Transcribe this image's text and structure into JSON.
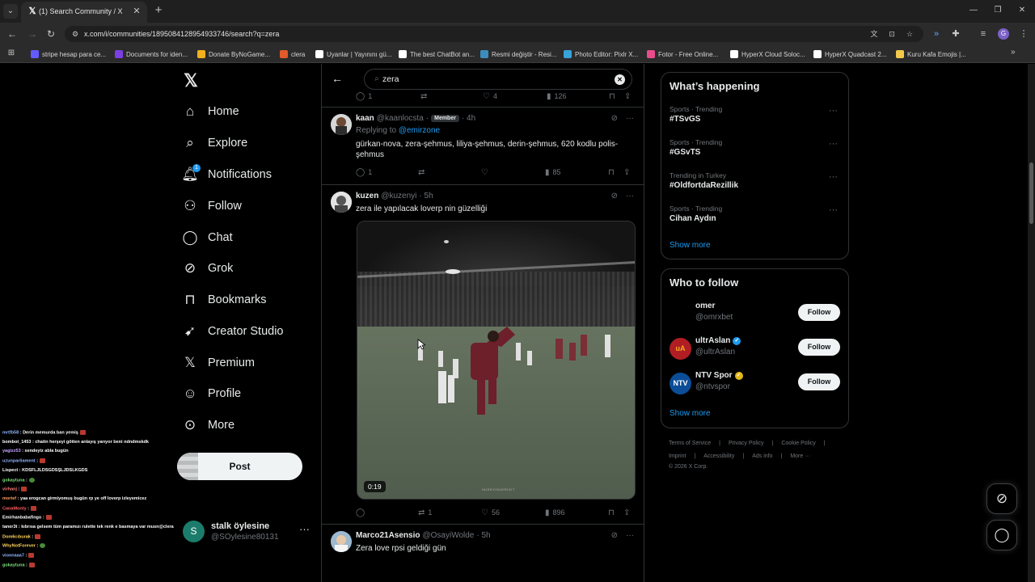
{
  "browser": {
    "tab_title": "(1) Search Community / X",
    "url": "x.com/i/communities/1895084128954933746/search?q=zera",
    "bookmarks": [
      {
        "label": "stripe hesap para ce...",
        "color": "#635bff"
      },
      {
        "label": "Documents for iden...",
        "color": "#7b3fe4"
      },
      {
        "label": "Donate ByNoGame...",
        "color": "#f2b01e"
      },
      {
        "label": "clera",
        "color": "#e05a2b"
      },
      {
        "label": "Uyanlar | Yayınını gü...",
        "color": "#ffffff"
      },
      {
        "label": "The best ChatBot an...",
        "color": "#ffffff"
      },
      {
        "label": "Resmi değiştir - Resi...",
        "color": "#3c8dbc"
      },
      {
        "label": "Photo Editor: Pixlr X...",
        "color": "#36a3d9"
      },
      {
        "label": "Fotor - Free Online...",
        "color": "#e84c8b"
      },
      {
        "label": "HyperX Cloud Soloc...",
        "color": "#ffffff"
      },
      {
        "label": "HyperX Quadcast 2...",
        "color": "#ffffff"
      },
      {
        "label": "Kuru Kafa Emojis |...",
        "color": "#f2c94c"
      }
    ]
  },
  "nav": {
    "items": [
      {
        "label": "Home",
        "icon": "home-icon"
      },
      {
        "label": "Explore",
        "icon": "search-icon"
      },
      {
        "label": "Notifications",
        "icon": "bell-icon",
        "badge": "1"
      },
      {
        "label": "Follow",
        "icon": "follow-icon"
      },
      {
        "label": "Chat",
        "icon": "chat-icon"
      },
      {
        "label": "Grok",
        "icon": "grok-icon"
      },
      {
        "label": "Bookmarks",
        "icon": "bookmark-icon"
      },
      {
        "label": "Creator Studio",
        "icon": "rocket-icon"
      },
      {
        "label": "Premium",
        "icon": "x-icon"
      },
      {
        "label": "Profile",
        "icon": "person-icon"
      },
      {
        "label": "More",
        "icon": "more-circle-icon"
      }
    ],
    "post_label": "Post",
    "account": {
      "avatar_letter": "S",
      "name": "stalk öylesine",
      "handle": "@SOylesine80131"
    }
  },
  "search": {
    "query": "zera"
  },
  "top_actions": {
    "replies": "1",
    "reposts": "",
    "likes": "4",
    "views": "126"
  },
  "tweets": [
    {
      "name": "kaan",
      "handle": "@kaanlocsta",
      "badge": "Member",
      "time": "· 4h",
      "replying_prefix": "Replying to",
      "replying_to": "@emirzone",
      "text": "gürkan-nova, zera-şehmus, liliya-şehmus, derin-şehmus, 620 kodlu polis-şehmus",
      "replies": "1",
      "reposts": "",
      "likes": "",
      "views": "85"
    },
    {
      "name": "kuzen",
      "handle": "@kuzenyi",
      "time": "· 5h",
      "text": "zera ile yapılacak loverp nin güzelliği",
      "video_duration": "0:19",
      "video_watermark": "HUSEYINVERIGIT",
      "replies": "",
      "reposts": "1",
      "likes": "56",
      "views": "896"
    },
    {
      "name": "Marco21Asensio",
      "handle": "@OsayiWolde",
      "time": "· 5h",
      "text": "Zera love rpsi geldiği gün"
    }
  ],
  "whats_happening": {
    "title": "What’s happening",
    "trends": [
      {
        "meta": "Sports · Trending",
        "name": "#TSvGS"
      },
      {
        "meta": "Sports · Trending",
        "name": "#GSvTS"
      },
      {
        "meta": "Trending in Turkey",
        "name": "#OldfortdaRezillik"
      },
      {
        "meta": "Sports · Trending",
        "name": "Cihan Aydın"
      }
    ],
    "show_more": "Show more"
  },
  "who_to_follow": {
    "title": "Who to follow",
    "accounts": [
      {
        "name": "omer",
        "handle": "@omrxbet",
        "verified": "",
        "avatar_text": ""
      },
      {
        "name": "ultrAslan",
        "handle": "@ultrAslan",
        "verified": "blue",
        "avatar_text": "uA"
      },
      {
        "name": "NTV Spor",
        "handle": "@ntvspor",
        "verified": "gold",
        "avatar_text": "NTV"
      }
    ],
    "follow_label": "Follow",
    "show_more": "Show more"
  },
  "footer": {
    "links": [
      "Terms of Service",
      "|",
      "Privacy Policy",
      "|",
      "Cookie Policy",
      "|"
    ],
    "links2": [
      "Imprint",
      "|",
      "Accessibility",
      "|",
      "Ads info",
      "|",
      "More ···"
    ],
    "copyright": "© 2026 X Corp."
  },
  "stream_chat": [
    {
      "user": "mrtfb58",
      "msg": ": Derin memurda ban yemiş",
      "color": "#8fb4ff",
      "emo": "r"
    },
    {
      "user": "bombot_1453",
      "msg": ": chatin herşeyi götten anlayış yarıyor beni ndndmskdk",
      "color": "#ffffff",
      "emo": ""
    },
    {
      "user": "yagizz53",
      "msg": ": sendeyiz abla bugün",
      "color": "#c5a3ff",
      "emo": ""
    },
    {
      "user": "uzunparliament",
      "msg": ":",
      "color": "#8fb4ff",
      "emo": "r"
    },
    {
      "user": "Lispect",
      "msg": ": KDSFLJLDSGDSŞLJDSLKGDS",
      "color": "#ffffff",
      "emo": ""
    },
    {
      "user": "gokaytuna",
      "msg": ":",
      "color": "#7be07b",
      "emo": "g"
    },
    {
      "user": "virhanj",
      "msg": ":",
      "color": "#ff7a7a",
      "emo": "r"
    },
    {
      "user": "mortef",
      "msg": ": yaa erogcan girmiyomuş bugün rp ye off loverp izleyemicez",
      "color": "#ff9b5e",
      "emo": ""
    },
    {
      "user": "CanaMonty",
      "msg": ":",
      "color": "#ff5f5f",
      "emo": "r"
    },
    {
      "user": "Emirhanbabafingo",
      "msg": ":",
      "color": "#ffffff",
      "emo": "r"
    },
    {
      "user": "taner3t",
      "msg": ": kıbrısa gelsem tüm paramızı rulette tek renk e basmaya var musn@clera",
      "color": "#ffffff",
      "emo": ""
    },
    {
      "user": "Dom6cıburak",
      "msg": ":",
      "color": "#ffd35e",
      "emo": "r"
    },
    {
      "user": "WhyNotForever",
      "msg": ":",
      "color": "#ffd35e",
      "emo": "g"
    },
    {
      "user": "vionnaaa7",
      "msg": ":",
      "color": "#8fb4ff",
      "emo": "r"
    },
    {
      "user": "gokaytuna",
      "msg": ":",
      "color": "#7be07b",
      "emo": "r"
    }
  ],
  "colors": {
    "accent": "#1d9bf0",
    "background": "#000000",
    "border": "#2f3336",
    "muted": "#71767b"
  }
}
